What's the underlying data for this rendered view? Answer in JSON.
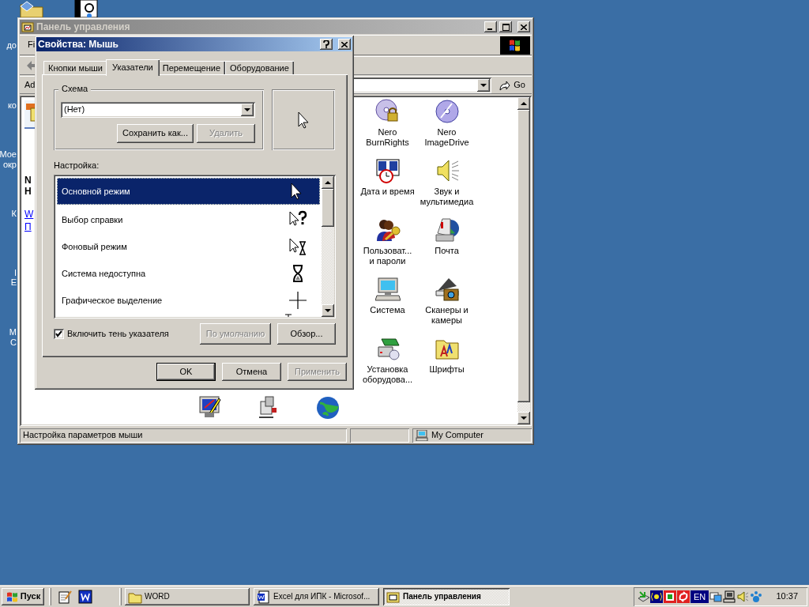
{
  "desktop": {
    "icon_labels": [
      "до",
      "ко",
      "Мое",
      "окр",
      "К",
      "I",
      "E",
      "М",
      "С"
    ]
  },
  "control_panel": {
    "title": "Панель управления",
    "menu_fragment": "Fi",
    "address_label": "Ad",
    "go_button": "Go",
    "left_pane_fragments": [
      {
        "text": "N",
        "kind": "heading"
      },
      {
        "text": "H",
        "kind": "heading"
      },
      {
        "text": "W",
        "kind": "link"
      },
      {
        "text": "П",
        "kind": "link"
      }
    ],
    "items": [
      {
        "lines": [
          "Nero",
          "BurnRights"
        ]
      },
      {
        "lines": [
          "Nero",
          "ImageDrive"
        ]
      },
      {
        "lines": [
          "Дата и время"
        ]
      },
      {
        "lines": [
          "Звук и",
          "мультимедиа"
        ]
      },
      {
        "lines": [
          "Пользоват...",
          "и пароли"
        ]
      },
      {
        "lines": [
          "Почта"
        ]
      },
      {
        "lines": [
          "Система"
        ]
      },
      {
        "lines": [
          "Сканеры и",
          "камеры"
        ]
      },
      {
        "lines": [
          "Установка",
          "оборудова..."
        ]
      },
      {
        "lines": [
          "Шрифты"
        ]
      }
    ],
    "status_bar": {
      "text": "Настройка параметров мыши",
      "zone": "My Computer"
    }
  },
  "mouse_dialog": {
    "title": "Свойства: Мышь",
    "tabs": [
      {
        "label": "Кнопки мыши",
        "selected": false
      },
      {
        "label": "Указатели",
        "selected": true
      },
      {
        "label": "Перемещение",
        "selected": false
      },
      {
        "label": "Оборудование",
        "selected": false
      }
    ],
    "scheme_label": "Схема",
    "scheme_value": "(Нет)",
    "scheme_buttons": [
      {
        "label": "Сохранить как...",
        "disabled": false
      },
      {
        "label": "Удалить",
        "disabled": true
      }
    ],
    "settings_label": "Настройка:",
    "cursors": [
      {
        "label": "Основной режим",
        "kind": "arrow",
        "selected": true
      },
      {
        "label": "Выбор справки",
        "kind": "help",
        "selected": false
      },
      {
        "label": "Фоновый режим",
        "kind": "busy",
        "selected": false
      },
      {
        "label": "Система недоступна",
        "kind": "wait",
        "selected": false
      },
      {
        "label": "Графическое выделение",
        "kind": "cross",
        "selected": false
      }
    ],
    "shadow": {
      "label": "Включить тень указателя",
      "checked": true
    },
    "list_buttons": [
      {
        "label": "По умолчанию",
        "disabled": true
      },
      {
        "label": "Обзор...",
        "disabled": false
      }
    ],
    "footer_buttons": [
      {
        "label": "OK",
        "disabled": false,
        "default": true
      },
      {
        "label": "Отмена",
        "disabled": false,
        "default": false
      },
      {
        "label": "Применить",
        "disabled": true,
        "default": false
      }
    ]
  },
  "taskbar": {
    "start": "Пуск",
    "tasks": [
      {
        "label": "WORD",
        "selected": false
      },
      {
        "label": "Excel для ИПК - Microsof...",
        "selected": false
      },
      {
        "label": "Панель управления",
        "selected": true
      }
    ],
    "language": "EN",
    "clock": "10:37"
  }
}
